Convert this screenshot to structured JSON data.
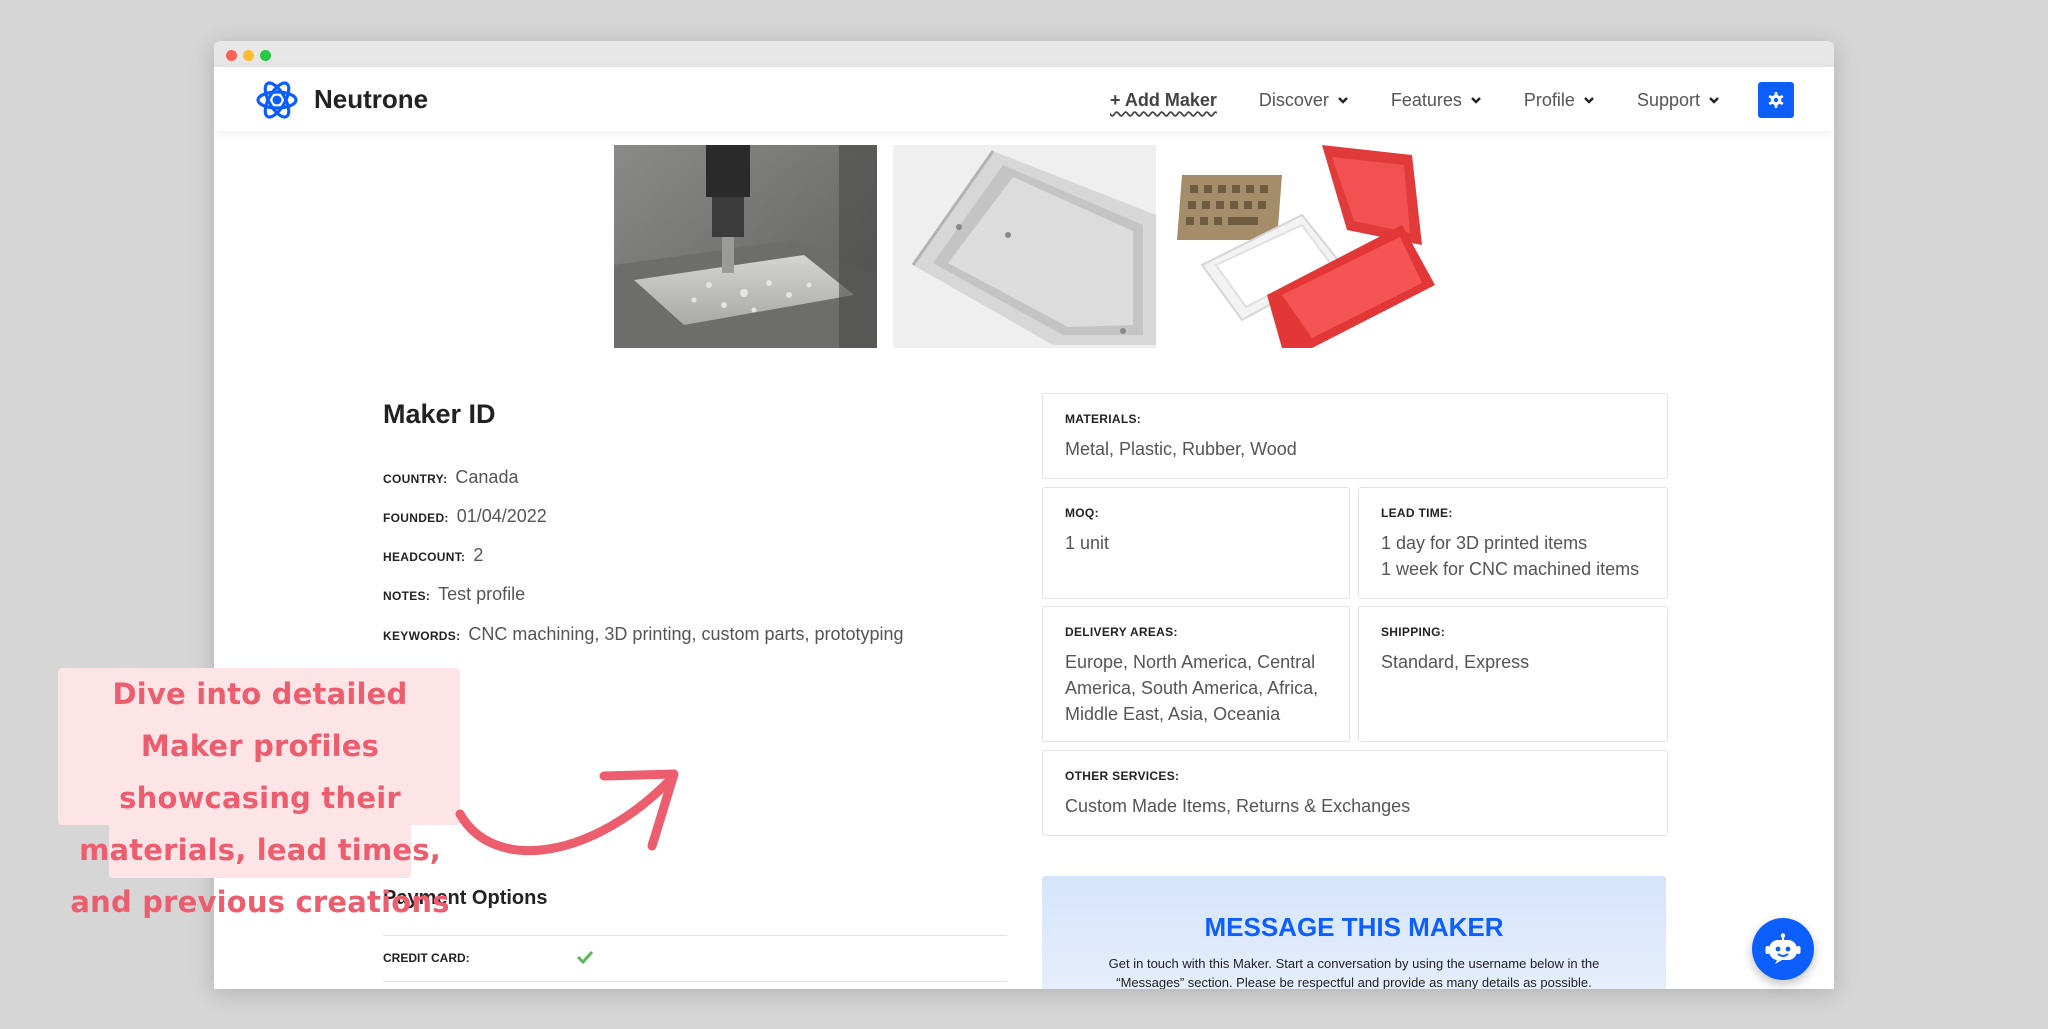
{
  "brand": {
    "name": "Neutrone"
  },
  "nav": {
    "add_maker": "+ Add Maker",
    "discover": "Discover",
    "features": "Features",
    "profile": "Profile",
    "support": "Support"
  },
  "maker": {
    "title": "Maker ID",
    "fields": [
      {
        "label": "COUNTRY:",
        "value": "Canada"
      },
      {
        "label": "FOUNDED:",
        "value": "01/04/2022"
      },
      {
        "label": "HEADCOUNT:",
        "value": "2"
      },
      {
        "label": "NOTES:",
        "value": "Test profile"
      },
      {
        "label": "KEYWORDS:",
        "value": "CNC machining, 3D printing, custom parts, prototyping"
      }
    ]
  },
  "cards": {
    "materials": {
      "label": "MATERIALS:",
      "value": "Metal, Plastic, Rubber, Wood"
    },
    "moq": {
      "label": "MOQ:",
      "value": "1 unit"
    },
    "lead_time": {
      "label": "LEAD TIME:",
      "value": "1 day for 3D printed items\n1 week for CNC machined items"
    },
    "delivery_areas": {
      "label": "DELIVERY AREAS:",
      "value": "Europe, North America, Central\nAmerica, South America, Africa,\nMiddle East, Asia, Oceania"
    },
    "shipping": {
      "label": "SHIPPING:",
      "value": "Standard, Express"
    },
    "other_services": {
      "label": "OTHER SERVICES:",
      "value": "Custom Made Items, Returns & Exchanges"
    }
  },
  "payment": {
    "title": "Payment Options",
    "options": [
      {
        "label": "CREDIT CARD:",
        "accepted": true
      }
    ]
  },
  "message": {
    "title": "MESSAGE THIS MAKER",
    "description": "Get in touch with this Maker. Start a conversation by using the username below in the “Messages” section. Please be respectful and provide as many details as possible."
  },
  "callout": {
    "text": "Dive into detailed Maker profiles showcasing their materials, lead times, and previous creations"
  },
  "colors": {
    "accent": "#0d5ffd",
    "callout_text": "#ec5d6e",
    "callout_bg": "#fde5e7",
    "check": "#5cb85c"
  },
  "icons": {
    "logo": "atom-icon",
    "settings": "gear-icon",
    "chat": "chatbot-icon",
    "check": "checkmark-icon",
    "dropdown": "chevron-down-icon"
  }
}
